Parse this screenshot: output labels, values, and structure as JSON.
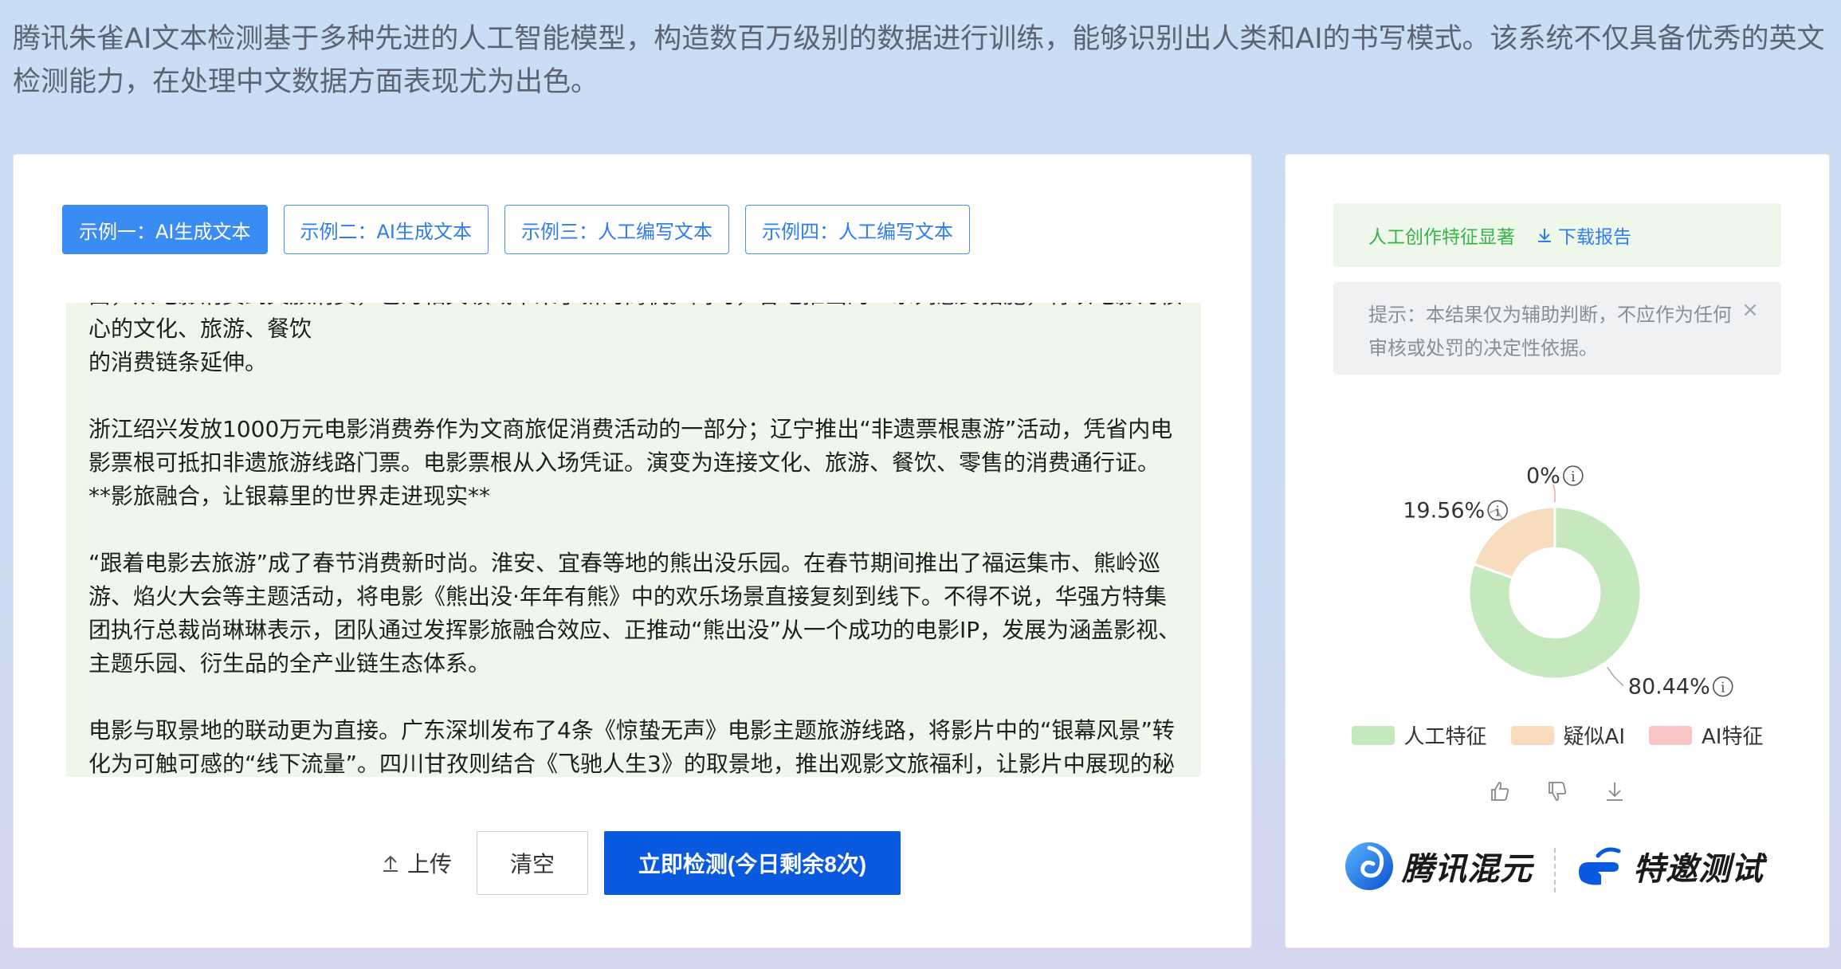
{
  "intro": "腾讯朱雀AI文本检测基于多种先进的人工智能模型，构造数百万级别的数据进行训练，能够识别出人类和AI的书写模式。该系统不仅具备优秀的英文检测能力，在处理中文数据方面表现尤为出色。",
  "tabs": [
    {
      "label": "示例一：AI生成文本",
      "active": true
    },
    {
      "label": "示例二：AI生成文本",
      "active": false
    },
    {
      "label": "示例三：人工编写文本",
      "active": false
    },
    {
      "label": "示例四：人工编写文本",
      "active": false
    }
  ],
  "text_content": {
    "partial_line": "由，从电影消费到文旅消费，也为相关领域带来了新的商机。同时，各地推出的一系列惠民措施，将以电影为核心的文化、旅游、餐饮",
    "paragraphs": [
      "的消费链条延伸。",
      "浙江绍兴发放1000万元电影消费券作为文商旅促消费活动的一部分；辽宁推出“非遗票根惠游”活动，凭省内电影票根可抵扣非遗旅游线路门票。电影票根从入场凭证。演变为连接文化、旅游、餐饮、零售的消费通行证。 **影旅融合，让银幕里的世界走进现实**",
      "“跟着电影去旅游”成了春节消费新时尚。淮安、宜春等地的熊出没乐园。在春节期间推出了福运集市、熊岭巡游、焰火大会等主题活动，将电影《熊出没·年年有熊》中的欢乐场景直接复刻到线下。不得不说，华强方特集团执行总裁尚琳琳表示，团队通过发挥影旅融合效应、正推动“熊出没”从一个成功的电影IP，发展为涵盖影视、主题乐园、衍生品的全产业链生态体系。",
      "电影与取景地的联动更为直接。广东深圳发布了4条《惊蛰无声》电影主题旅游线路，将影片中的“银幕风景”转化为可触可感的“线下流量”。四川甘孜则结合《飞驰人生3》的取景地，推出观影文旅福利，让影片中展现的秘境风光吸引更多游客前往。"
    ]
  },
  "actions": {
    "upload": "上传",
    "clear": "清空",
    "detect": "立即检测(今日剩余8次)"
  },
  "result": {
    "label": "人工创作特征显著",
    "download": "下载报告",
    "tip": "提示：本结果仅为辅助判断，不应作为任何审核或处罚的决定性依据。"
  },
  "chart_data": {
    "type": "pie",
    "categories": [
      "人工特征",
      "疑似AI",
      "AI特征"
    ],
    "values": [
      80.44,
      19.56,
      0
    ],
    "labels": [
      "80.44%",
      "19.56%",
      "0%"
    ],
    "colors": [
      "#c5e8bf",
      "#f7dcbd",
      "#f8c4c4"
    ],
    "legend": "bottom"
  },
  "feedback": {
    "like_icon": "thumbs-up-icon",
    "dislike_icon": "thumbs-down-icon",
    "download_icon": "download-icon"
  },
  "brand": {
    "left": "腾讯混元",
    "right": "特邀测试"
  }
}
